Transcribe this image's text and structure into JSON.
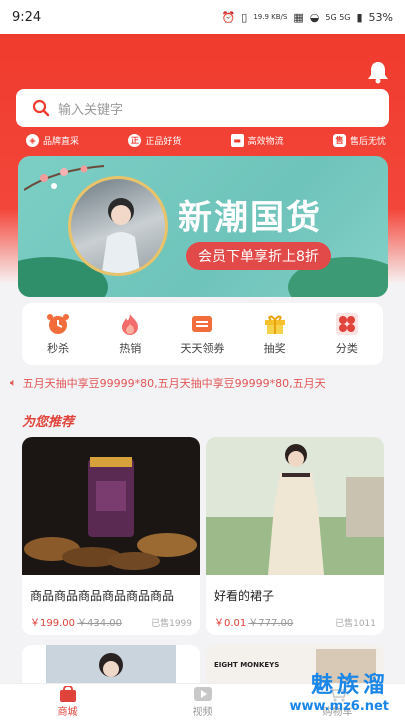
{
  "status": {
    "time": "9:24",
    "speed": "19.9 KB/S",
    "network": "5G 5G",
    "battery": "53%"
  },
  "header": {
    "bell_icon": "bell-icon"
  },
  "search": {
    "placeholder": "输入关键字"
  },
  "features": [
    {
      "label": "品牌直采",
      "icon": "tag-icon"
    },
    {
      "label": "正品好货",
      "icon_text": "正"
    },
    {
      "label": "高效物流",
      "icon": "truck-icon"
    },
    {
      "label": "售后无忧",
      "icon_text": "售"
    }
  ],
  "banner": {
    "title": "新潮国货",
    "subtitle": "会员下单享折上8折"
  },
  "categories": [
    {
      "label": "秒杀",
      "icon": "alarm-clock-icon"
    },
    {
      "label": "热销",
      "icon": "flame-icon"
    },
    {
      "label": "天天领券",
      "icon": "coupon-icon"
    },
    {
      "label": "抽奖",
      "icon": "gift-icon"
    },
    {
      "label": "分类",
      "icon": "grid-icon"
    }
  ],
  "marquee": {
    "text": "五月天抽中享豆99999*80,五月天抽中享豆99999*80,五月天"
  },
  "recommend": {
    "title": "为您推荐"
  },
  "products": [
    {
      "name": "商品商品商品商品商品商品",
      "price": "￥199.00",
      "original": "￥434.00",
      "sold": "已售1999"
    },
    {
      "name": "好看的裙子",
      "price": "￥0.01",
      "original": "￥777.00",
      "sold": "已售1011"
    }
  ],
  "tabs": [
    {
      "label": "商城",
      "active": true
    },
    {
      "label": "视频",
      "active": false
    },
    {
      "label": "购物车",
      "active": false
    }
  ],
  "watermark": {
    "brand": "魅族溜",
    "url": "www.mz6.net"
  },
  "colors": {
    "primary": "#ef3b2e",
    "price": "#e0433a",
    "teal_banner": "#7ccfc5"
  }
}
